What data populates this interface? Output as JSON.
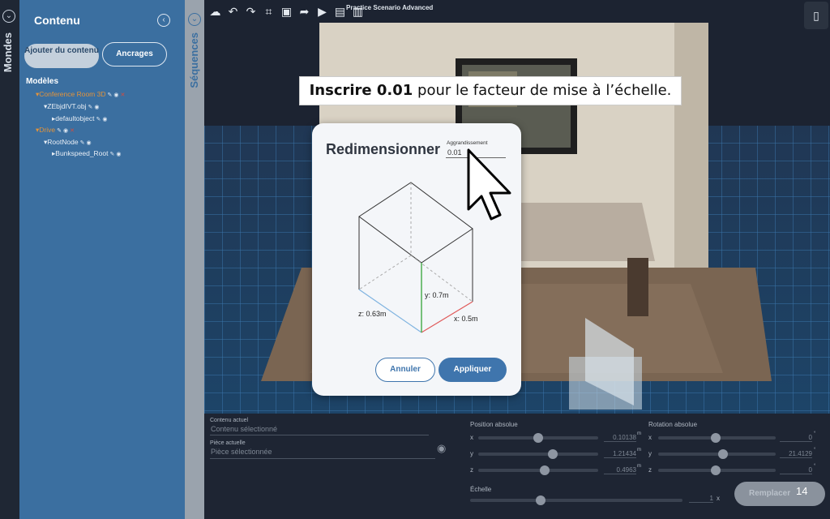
{
  "sidebar": {
    "mondes_label": "Mondes",
    "content_title": "Contenu",
    "add_content_label": "Ajouter du contenu",
    "anchors_label": "Ancrages",
    "models_label": "Modèles",
    "tree": [
      {
        "label": "Conference Room 3D",
        "level": 0,
        "orange": true
      },
      {
        "label": "ZEbjdIVT.obj",
        "level": 1,
        "orange": false
      },
      {
        "label": "defaultobject",
        "level": 2,
        "orange": false
      },
      {
        "label": "Drive",
        "level": 0,
        "orange": true
      },
      {
        "label": "RootNode",
        "level": 1,
        "orange": false
      },
      {
        "label": "Bunkspeed_Root",
        "level": 2,
        "orange": false
      }
    ],
    "sequences_label": "Séquences"
  },
  "toolbar": {
    "scenario_title": "Practice Scenario Advanced"
  },
  "instruction": {
    "bold": "Inscrire 0.01",
    "rest": " pour le facteur de mise à l’échelle."
  },
  "dialog": {
    "title": "Redimensionner",
    "scale_label": "Aggrandissement",
    "scale_value": "0.01",
    "y_dim": "y: 0.7m",
    "z_dim": "z: 0.63m",
    "x_dim": "x: 0.5m",
    "cancel_label": "Annuler",
    "apply_label": "Appliquer"
  },
  "properties": {
    "current_content_label": "Contenu actuel",
    "current_content_placeholder": "Contenu sélectionné",
    "current_room_label": "Pièce actuelle",
    "current_room_placeholder": "Pièce sélectionnée",
    "abs_position_label": "Position absolue",
    "abs_rotation_label": "Rotation absolue",
    "pos_x": "0.10138",
    "pos_y": "1.21434",
    "pos_z": "0.4963",
    "pos_unit": "m",
    "rot_x": "0",
    "rot_y": "21.4129",
    "rot_z": "0",
    "rot_unit": "°",
    "scale_label": "Échelle",
    "scale_value": "1",
    "scale_unit": "x",
    "axis_x": "x",
    "axis_y": "y",
    "axis_z": "z",
    "replace_label": "Remplacer"
  },
  "page_number": "14"
}
